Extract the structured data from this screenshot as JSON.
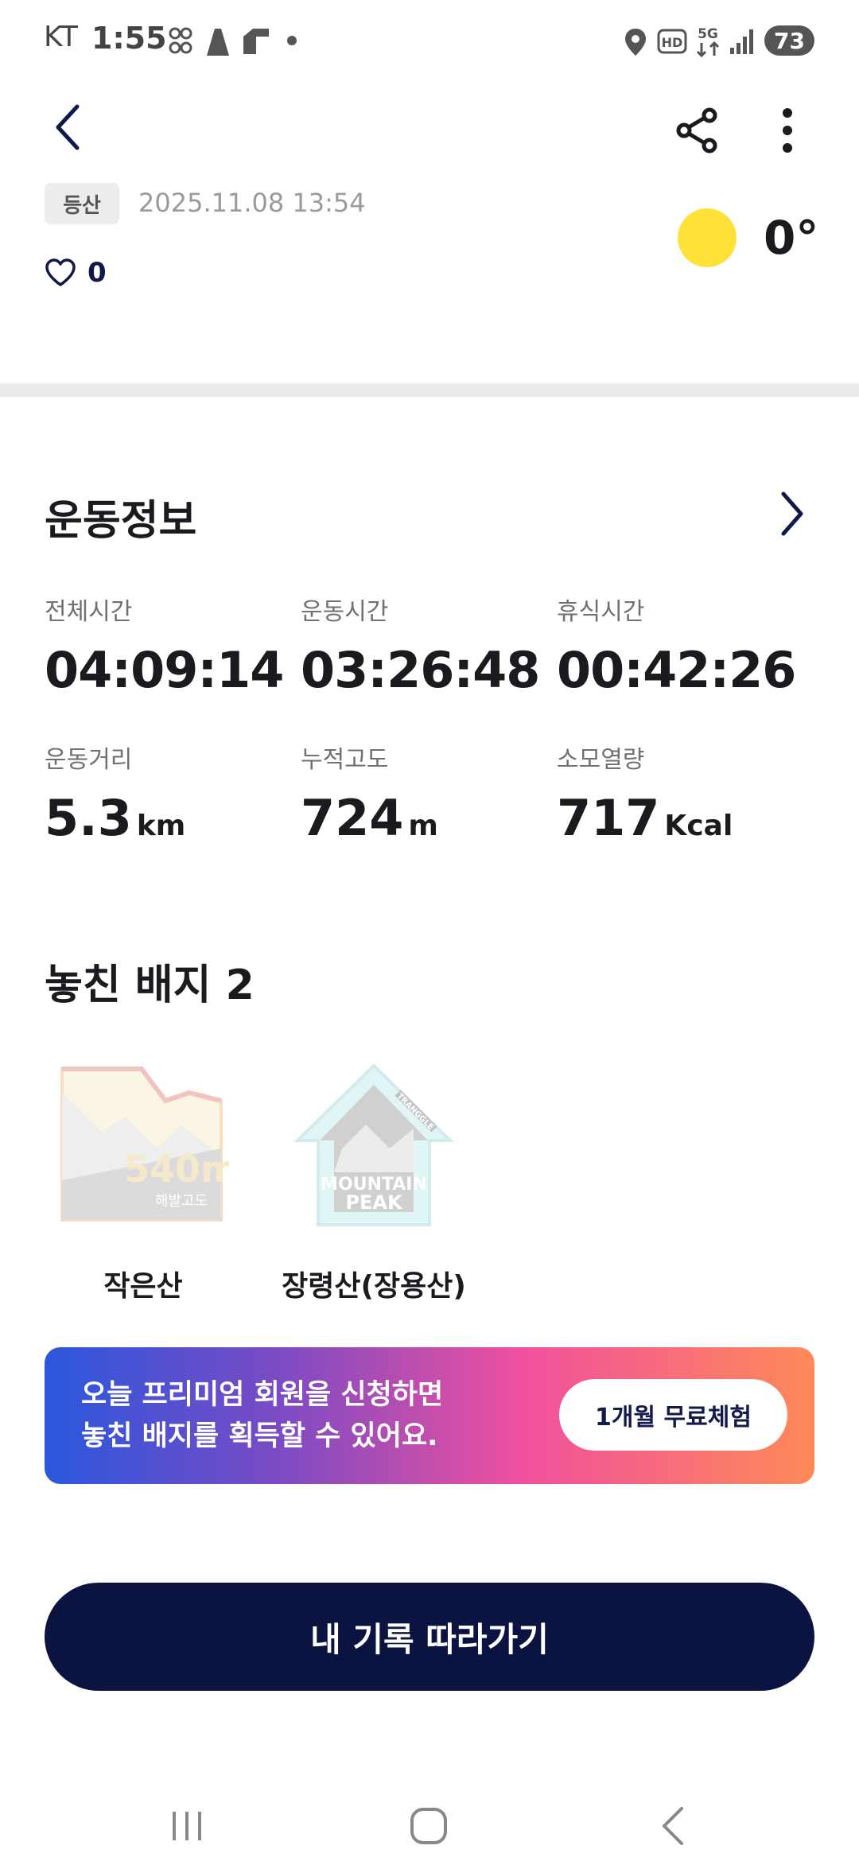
{
  "status_bar": {
    "carrier": "KT",
    "time": "1:55",
    "battery": "73",
    "icons": [
      "app-notification-icon",
      "app-notification-icon",
      "app-notification-icon",
      "dot-icon",
      "location-icon",
      "hd-icon",
      "5g-icon",
      "signal-icon",
      "battery-icon"
    ]
  },
  "header": {
    "back_icon": "back-arrow-icon",
    "share_icon": "share-icon",
    "more_icon": "more-vertical-icon"
  },
  "record": {
    "tag": "등산",
    "datetime": "2025.11.08 13:54",
    "like_count": "0",
    "temperature": "0°",
    "weather_icon": "sun-icon"
  },
  "exercise_info": {
    "title": "운동정보",
    "stats_row1": [
      {
        "label": "전체시간",
        "value": "04:09:14"
      },
      {
        "label": "운동시간",
        "value": "03:26:48"
      },
      {
        "label": "휴식시간",
        "value": "00:42:26"
      }
    ],
    "stats_row2": [
      {
        "label": "운동거리",
        "value": "5.3",
        "unit": "km"
      },
      {
        "label": "누적고도",
        "value": "724",
        "unit": "m"
      },
      {
        "label": "소모열량",
        "value": "717",
        "unit": "Kcal"
      }
    ]
  },
  "missed_badges": {
    "title": "놓친 배지 2",
    "items": [
      {
        "name": "작은산",
        "badge_text": "540m",
        "badge_sub": "해발고도"
      },
      {
        "name": "장령산(장용산)",
        "badge_text_line1": "MOUNTAIN",
        "badge_text_line2": "PEAK",
        "badge_side": "TRANGGLE"
      }
    ]
  },
  "premium_banner": {
    "line1": "오늘 프리미엄 회원을 신청하면",
    "line2": "놓친 배지를 획득할 수 있어요.",
    "button": "1개월 무료체험"
  },
  "follow_button": "내 기록 따라가기",
  "nav_bar": [
    "recent-apps-icon",
    "home-icon",
    "back-icon"
  ],
  "colors": {
    "navy": "#0b1340",
    "sun": "#ffe13a",
    "banner_start": "#2a57dd",
    "banner_mid": "#f0509e",
    "banner_end": "#ff8a58"
  }
}
